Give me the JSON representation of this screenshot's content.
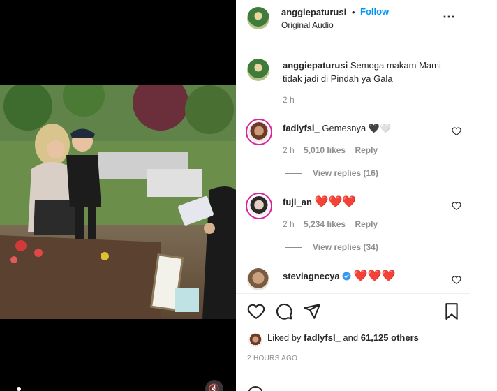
{
  "header": {
    "username": "anggiepaturusi",
    "separator": "•",
    "follow_label": "Follow",
    "audio_label": "Original Audio",
    "more_icon": "more-horizontal-icon"
  },
  "caption": {
    "username": "anggiepaturusi",
    "text": "Semoga makam Mami tidak jadi di Pindah ya Gala",
    "time": "2 h"
  },
  "comments": [
    {
      "username": "fadlyfsl_",
      "text": "Gemesnya 🖤🤍",
      "time": "2 h",
      "likes": "5,010 likes",
      "reply": "Reply",
      "view_replies": "View replies (16)"
    },
    {
      "username": "fuji_an",
      "text": "❤️❤️❤️",
      "time": "2 h",
      "likes": "5,234 likes",
      "reply": "Reply",
      "view_replies": "View replies (34)"
    },
    {
      "username": "steviagnecya",
      "text": "❤️❤️❤️",
      "verified": true
    }
  ],
  "footer": {
    "liked_prefix": "Liked by",
    "liked_user": "fadlyfsl_",
    "liked_mid": "and",
    "liked_others": "61,125 others",
    "time_ago": "2 HOURS AGO"
  },
  "colors": {
    "accent": "#0095f6",
    "heart": "#ed4956",
    "muted": "#8e8e8e",
    "text": "#262626"
  }
}
